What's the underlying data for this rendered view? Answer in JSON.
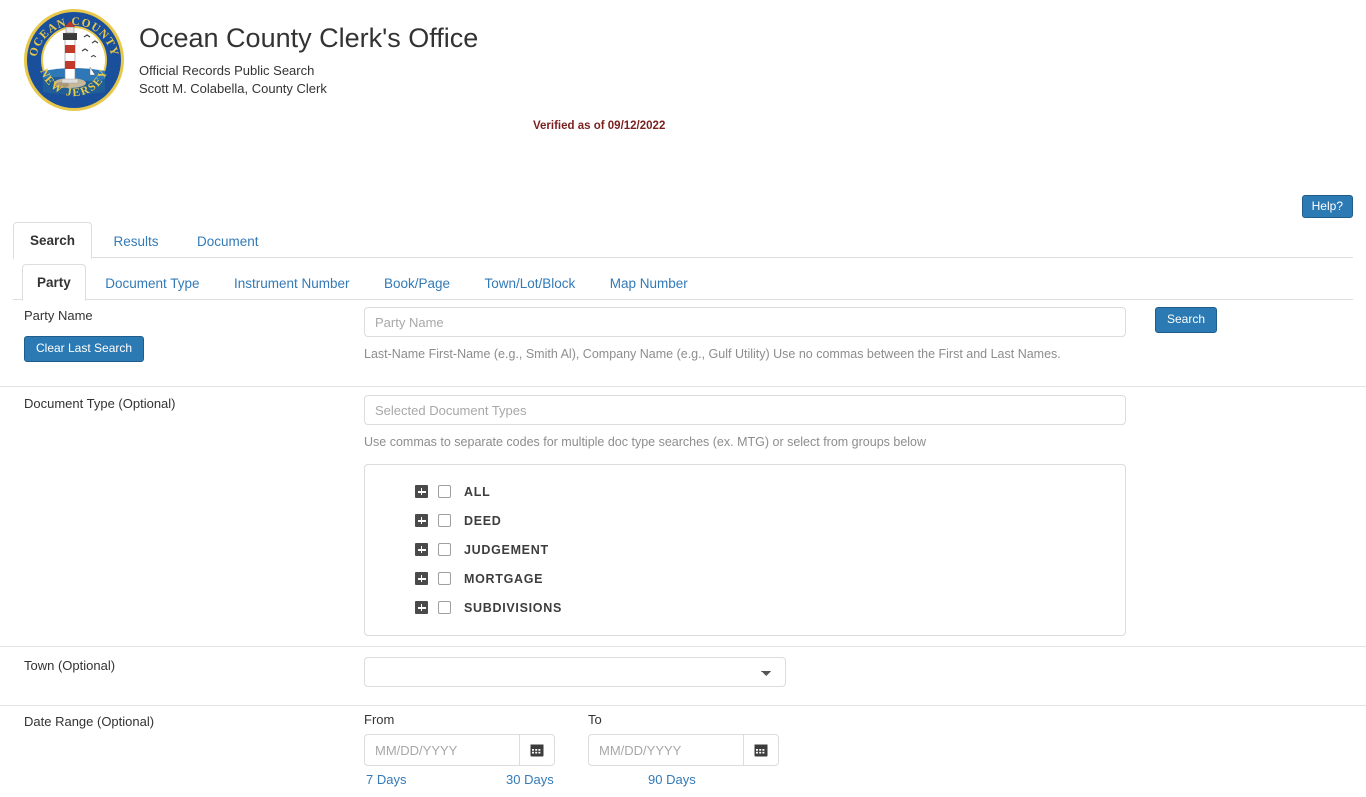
{
  "header": {
    "title": "Ocean County Clerk's Office",
    "subtitle_line1": "Official Records Public Search",
    "subtitle_line2": "Scott M. Colabella, County Clerk",
    "verified": "Verified as of 09/12/2022",
    "seal": {
      "top_text": "OCEAN COUNTY",
      "bottom_text": "NEW JERSEY",
      "icon": "ocean-county-nj-lighthouse-seal"
    }
  },
  "help_button": {
    "label": "Help?"
  },
  "primary_tabs": [
    {
      "label": "Search",
      "active": true
    },
    {
      "label": "Results",
      "active": false
    },
    {
      "label": "Document",
      "active": false
    }
  ],
  "secondary_tabs": [
    {
      "label": "Party",
      "active": true
    },
    {
      "label": "Document Type",
      "active": false
    },
    {
      "label": "Instrument Number",
      "active": false
    },
    {
      "label": "Book/Page",
      "active": false
    },
    {
      "label": "Town/Lot/Block",
      "active": false
    },
    {
      "label": "Map Number",
      "active": false
    }
  ],
  "party_row": {
    "label": "Party Name",
    "input_value": "",
    "input_placeholder": "Party Name",
    "help_text": "Last-Name First-Name (e.g., Smith Al), Company Name (e.g., Gulf Utility) Use no commas between the First and Last Names.",
    "clear_button": "Clear Last Search",
    "search_button": "Search"
  },
  "doc_type_row": {
    "label": "Document Type (Optional)",
    "input_value": "",
    "input_placeholder": "Selected Document Types",
    "help_text": "Use commas to separate codes for multiple doc type searches (ex. MTG) or select from groups below",
    "tree": [
      {
        "label": "ALL",
        "checked": false,
        "expanded": false
      },
      {
        "label": "DEED",
        "checked": false,
        "expanded": false
      },
      {
        "label": "JUDGEMENT",
        "checked": false,
        "expanded": false
      },
      {
        "label": "MORTGAGE",
        "checked": false,
        "expanded": false
      },
      {
        "label": "SUBDIVISIONS",
        "checked": false,
        "expanded": false
      }
    ]
  },
  "town_row": {
    "label": "Town (Optional)",
    "selected_value": "",
    "options": [
      ""
    ]
  },
  "date_row": {
    "label": "Date Range (Optional)",
    "from_label": "From",
    "to_label": "To",
    "from_value": "",
    "to_value": "",
    "date_placeholder": "MM/DD/YYYY",
    "calendar_icon": "calendar-icon",
    "quick_links": [
      "7 Days",
      "30 Days",
      "90 Days"
    ]
  },
  "colors": {
    "accent_blue": "#2b7ab3",
    "link_blue": "#337ab7",
    "verified_red": "#7b1f1f",
    "seal_blue": "#1a4f9c",
    "seal_gold": "#e8c84a",
    "border_grey": "#dcdcdc"
  }
}
